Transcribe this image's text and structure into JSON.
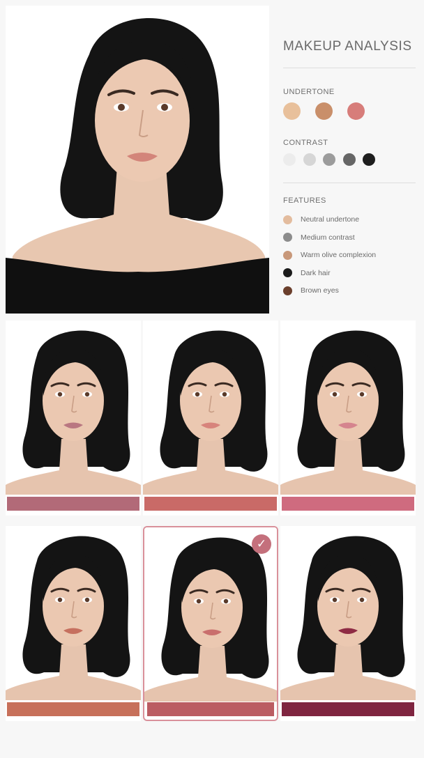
{
  "panel": {
    "title": "MAKEUP ANALYSIS",
    "undertone": {
      "label": "UNDERTONE",
      "swatches": [
        "#e8c09b",
        "#c98f6a",
        "#d77d7a"
      ]
    },
    "contrast": {
      "label": "CONTRAST",
      "swatches": [
        "#ececec",
        "#d6d6d6",
        "#9c9c9c",
        "#666666",
        "#1e1e1e"
      ]
    },
    "features": {
      "label": "FEATURES",
      "items": [
        {
          "text": "Neutral undertone",
          "color": "#e3bc9e"
        },
        {
          "text": "Medium contrast",
          "color": "#8c8c8c"
        },
        {
          "text": "Warm olive complexion",
          "color": "#c8987a"
        },
        {
          "text": "Dark hair",
          "color": "#1b1b1b"
        },
        {
          "text": "Brown eyes",
          "color": "#6b3f2c"
        }
      ]
    }
  },
  "looks": [
    {
      "lip": "#b97781",
      "swatch": "#b26a78",
      "selected": false
    },
    {
      "lip": "#d7847c",
      "swatch": "#c96a67",
      "selected": false
    },
    {
      "lip": "#d5848e",
      "swatch": "#cf6b7f",
      "selected": false
    },
    {
      "lip": "#c6705f",
      "swatch": "#c7705a",
      "selected": false
    },
    {
      "lip": "#c96f6d",
      "swatch": "#bb5c62",
      "selected": true,
      "check_glyph": "✓"
    },
    {
      "lip": "#8e2b44",
      "swatch": "#7f2540",
      "selected": false
    }
  ]
}
